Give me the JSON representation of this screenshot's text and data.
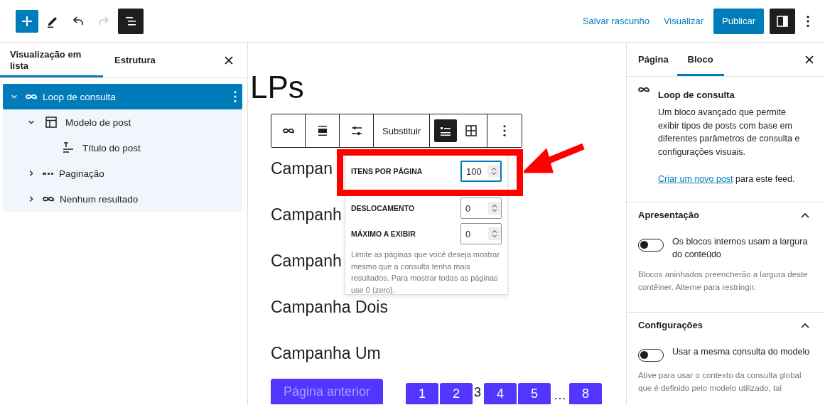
{
  "top_bar": {
    "tools": [
      {
        "kind": "add",
        "pressed": false
      },
      {
        "kind": "edit",
        "pressed": false
      },
      {
        "kind": "undo",
        "disabled": false
      },
      {
        "kind": "redo",
        "disabled": true
      },
      {
        "kind": "list-view",
        "pressed": true
      }
    ],
    "save_draft": "Salvar rascunho",
    "preview": "Visualizar",
    "publish": "Publicar",
    "settings_pressed": true
  },
  "list_view": {
    "tabs": [
      {
        "label": "Visualização em lista",
        "selected": true
      },
      {
        "label": "Estrutura",
        "selected": false
      }
    ],
    "items": [
      {
        "kind": "loop",
        "label": "Loop de consulta",
        "selected": true,
        "expanded": true,
        "children": [
          {
            "kind": "template",
            "label": "Modelo de post",
            "selected": false,
            "expanded": true,
            "children": [
              {
                "kind": "title",
                "label": "Título do post",
                "selected": false
              }
            ]
          },
          {
            "kind": "pagination",
            "label": "Paginação",
            "selected": false,
            "expanded": false
          },
          {
            "kind": "loop",
            "label": "Nenhum resultado",
            "selected": false,
            "expanded": false
          }
        ]
      }
    ]
  },
  "canvas": {
    "title": "LPs",
    "block_toolbar": {
      "replace": "Substituir",
      "layouts": [
        {
          "kind": "list",
          "selected": true
        },
        {
          "kind": "grid",
          "selected": false
        }
      ]
    },
    "query_popover": {
      "fields": [
        {
          "label": "ITENS POR PÁGINA",
          "value": "100",
          "focused": true
        },
        {
          "label": "DESLOCAMENTO",
          "value": "0",
          "focused": false
        },
        {
          "label": "MÁXIMO A EXIBIR",
          "value": "0",
          "focused": false
        }
      ],
      "help": "Limite as páginas que você deseja mostrar mesmo que a consulta tenha mais resultados. Para mostrar todas as páginas use 0 (zero)."
    },
    "posts": [
      "Campan",
      "Campanh",
      "Campanh",
      "Campanha Dois",
      "Campanha Um"
    ],
    "pagination": {
      "previous": "Página anterior",
      "pages": [
        {
          "label": "1",
          "current": false
        },
        {
          "label": "2",
          "current": false
        },
        {
          "label": "3",
          "current": true
        },
        {
          "label": "4",
          "current": false
        },
        {
          "label": "5",
          "current": false
        },
        {
          "label": "…",
          "kind": "dots"
        },
        {
          "label": "8",
          "current": false
        }
      ]
    }
  },
  "settings": {
    "tabs": [
      {
        "label": "Página",
        "selected": false
      },
      {
        "label": "Bloco",
        "selected": true
      }
    ],
    "block": {
      "title": "Loop de consulta",
      "description": "Um bloco avançado que permite exibir tipos de posts com base em diferentes parâmetros de consulta e configurações visuais.",
      "link": "Criar um novo post",
      "link_suffix": "para este feed."
    },
    "panels": [
      {
        "title": "Apresentação",
        "expanded": true,
        "toggle": {
          "label": "Os blocos internos usam a largura do conteúdo",
          "on": false
        },
        "help": "Blocos aninhados preencherão a largura deste contêiner. Alterne para restringir."
      },
      {
        "title": "Configurações",
        "expanded": true,
        "toggle": {
          "label": "Usar a mesma consulta do modelo",
          "on": false
        },
        "help": "Ative para usar o contexto da consulta global que é definido pelo modelo utilizado, tal"
      }
    ]
  }
}
